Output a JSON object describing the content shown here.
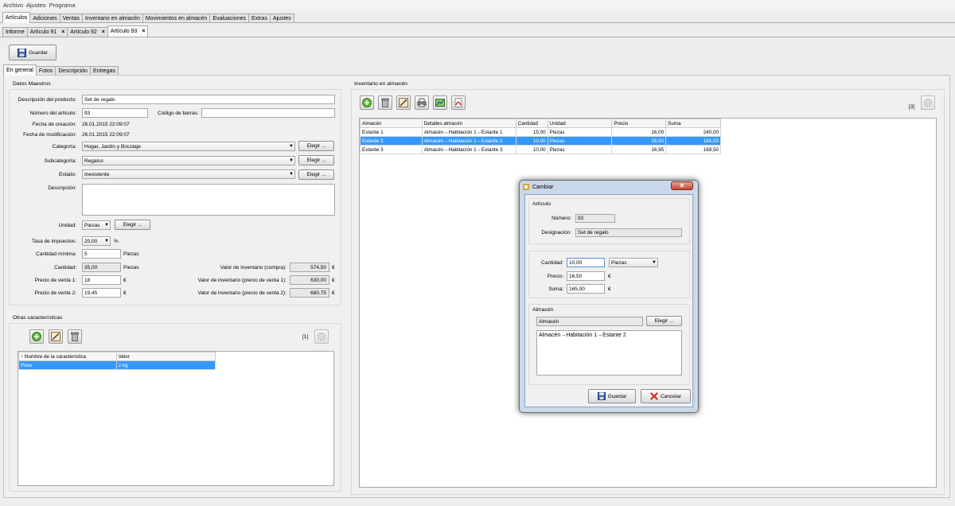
{
  "menu": [
    "Archivo",
    "Ajustes",
    "Programa"
  ],
  "main_tabs": [
    "Artículos",
    "Adiciones",
    "Ventas",
    "Inventario en almacén",
    "Movimientos en almacén",
    "Evaluaciones",
    "Extras",
    "Ajustes"
  ],
  "doc_tabs": [
    "Informe",
    "Artículo 91",
    "Artículo 92",
    "Artículo 93"
  ],
  "doc_tab_close": "×",
  "toolbar": {
    "save_label": "Guardar"
  },
  "sub_tabs": [
    "En general",
    "Fotos",
    "Descripción",
    "Entregas"
  ],
  "master": {
    "title": "Datos Maestros",
    "desc_label": "Descripción del producto:",
    "desc_value": "Set de regalo",
    "number_label": "Número del artículo:",
    "number_value": "93",
    "barcode_label": "Código de barras:",
    "barcode_value": "",
    "created_label": "Fecha de creación:",
    "created_value": "26.01.2015  22:09:07",
    "modified_label": "Fecha de modificación:",
    "modified_value": "26.01.2015  22:09:07",
    "category_label": "Categoría:",
    "category_value": "Hogar, Jardín y Bricolaje",
    "subcategory_label": "Subcategoría:",
    "subcategory_value": "Regalos",
    "state_label": "Estado:",
    "state_value": "Inexistente",
    "description_label": "Descripción:",
    "choose_label": "Elegir ...",
    "unit_label": "Unidad:",
    "unit_value": "Piezas",
    "tax_label": "Tasa de impuestos:",
    "tax_value": "20,00",
    "tax_unit": "%",
    "min_label": "Cantidad mínima:",
    "min_value": "5",
    "qty_label": "Cantidad:",
    "qty_value": "35,00",
    "pieces": "Piezas",
    "price1_label": "Precio de venta 1:",
    "price1_value": "18",
    "price2_label": "Precio de venta 2:",
    "price2_value": "19,45",
    "currency": "€",
    "inv_buy_label": "Valor de inventario (compra):",
    "inv_buy_value": "574,50",
    "inv_p1_label": "Valor de inventario (precio de venta 1):",
    "inv_p1_value": "630,00",
    "inv_p2_label": "Valor de inventario (precio de venta 2):",
    "inv_p2_value": "680,75"
  },
  "other": {
    "title": "Otras características",
    "count": "[1]",
    "columns": [
      "↑ Nombre de la característica",
      "Valor"
    ],
    "rows": [
      [
        "Peso",
        "2 kg"
      ]
    ]
  },
  "inventory": {
    "title": "Inventario en almacén",
    "count": "[3]",
    "columns": [
      "Almacén",
      "Detalles almacén",
      "Cantidad",
      "Unidad",
      "Precio",
      "Suma"
    ],
    "rows": [
      [
        "Estante 1",
        "Almacén→Habitación 1→Estante 1",
        "15,00",
        "Piezas",
        "16,00",
        "240,00"
      ],
      [
        "Estante 2",
        "Almacén→Habitación 1→Estante 2",
        "10,00",
        "Piezas",
        "16,50",
        "165,00"
      ],
      [
        "Estante 3",
        "Almacén→Habitación 1→Estante 3",
        "10,00",
        "Piezas",
        "16,95",
        "169,50"
      ]
    ],
    "selected_row": 1
  },
  "dialog": {
    "title": "Cambiar",
    "article_section": "Artículo",
    "number_label": "Número:",
    "number_value": "93",
    "designation_label": "Designación:",
    "designation_value": "Set de regalo",
    "qty_label": "Cantidad:",
    "qty_value": "10,00",
    "unit_value": "Piezas",
    "price_label": "Precio:",
    "price_value": "16,50",
    "sum_label": "Suma:",
    "sum_value": "165,00",
    "currency": "€",
    "warehouse_section": "Almacén",
    "warehouse_value": "Almacén",
    "choose_label": "Elegir ...",
    "path_value": "Almacén→Habitación 1→Estante 2",
    "save_label": "Guardar",
    "cancel_label": "Cancelar"
  },
  "colors": {
    "selection": "#3399ff",
    "dialog_frame": "#c9d8ea",
    "close_button": "#c74330"
  }
}
